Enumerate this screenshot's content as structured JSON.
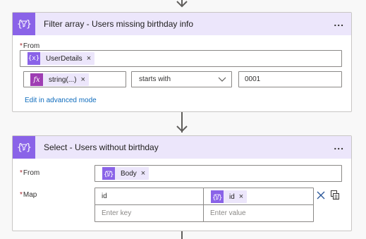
{
  "filter_card": {
    "title": "Filter array - Users missing birthday info",
    "icon": "braces-filter-icon",
    "more_label": "...",
    "from_label": "From",
    "from_token": {
      "label": "UserDetails",
      "icon": "variable-icon",
      "glyph": "{x}"
    },
    "condition": {
      "left_token": {
        "label": "string(...)",
        "icon": "fx-icon",
        "glyph": "fx"
      },
      "operator": "starts with",
      "value": "0001"
    },
    "advanced_link": "Edit in advanced mode"
  },
  "select_card": {
    "title": "Select - Users without birthday",
    "icon": "braces-filter-icon",
    "more_label": "...",
    "from_label": "From",
    "from_token": {
      "label": "Body",
      "icon": "braces-filter-icon"
    },
    "map_label": "Map",
    "map_rows": [
      {
        "key": "id",
        "value_token": {
          "label": "id",
          "icon": "braces-filter-icon"
        }
      },
      {
        "key_placeholder": "Enter key",
        "value_placeholder": "Enter value"
      }
    ]
  },
  "glyphs": {
    "close": "×",
    "required": "*"
  },
  "colors": {
    "accent": "#8a63e8",
    "header_bg": "#ece6fb",
    "fx": "#9e3db3",
    "link": "#0f6cbd"
  }
}
